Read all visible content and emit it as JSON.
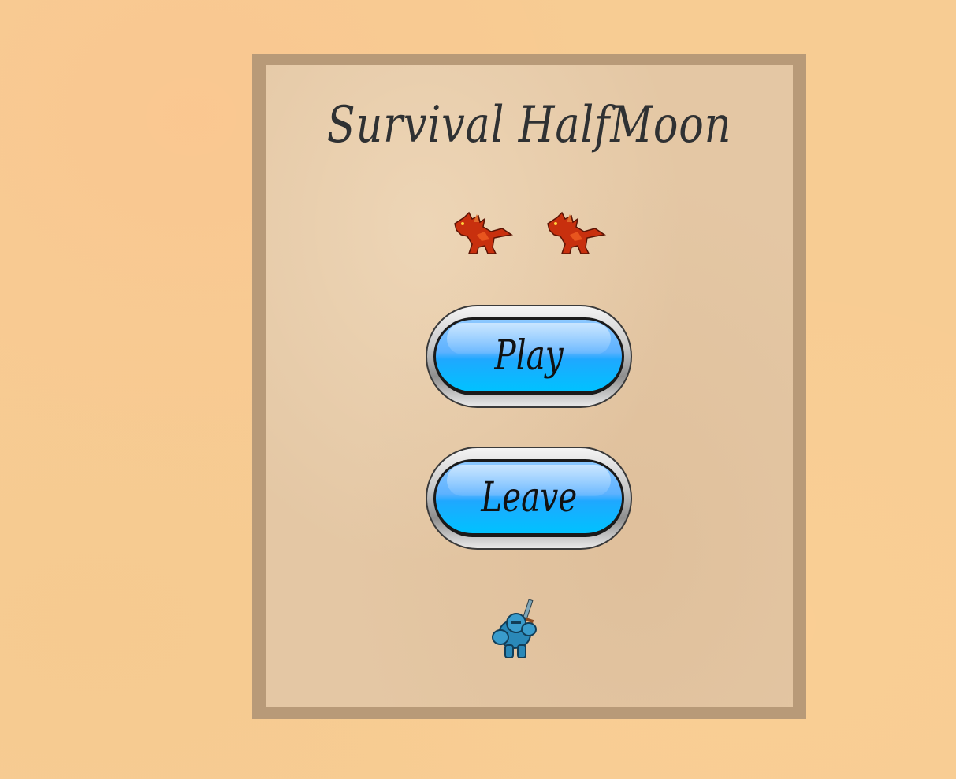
{
  "menu": {
    "title": "Survival HalfMoon",
    "play_label": "Play",
    "leave_label": "Leave",
    "decorations": {
      "top_icons": [
        "red-dragon-icon",
        "red-dragon-icon"
      ],
      "bottom_icon": "blue-knight-icon"
    }
  },
  "colors": {
    "background": "#f7cc93",
    "frame": "#b89a78",
    "panel": "#e4c7a4",
    "button_blue": "#1fa8ff",
    "dragon_red": "#c8300e",
    "knight_blue": "#2a88b8"
  }
}
